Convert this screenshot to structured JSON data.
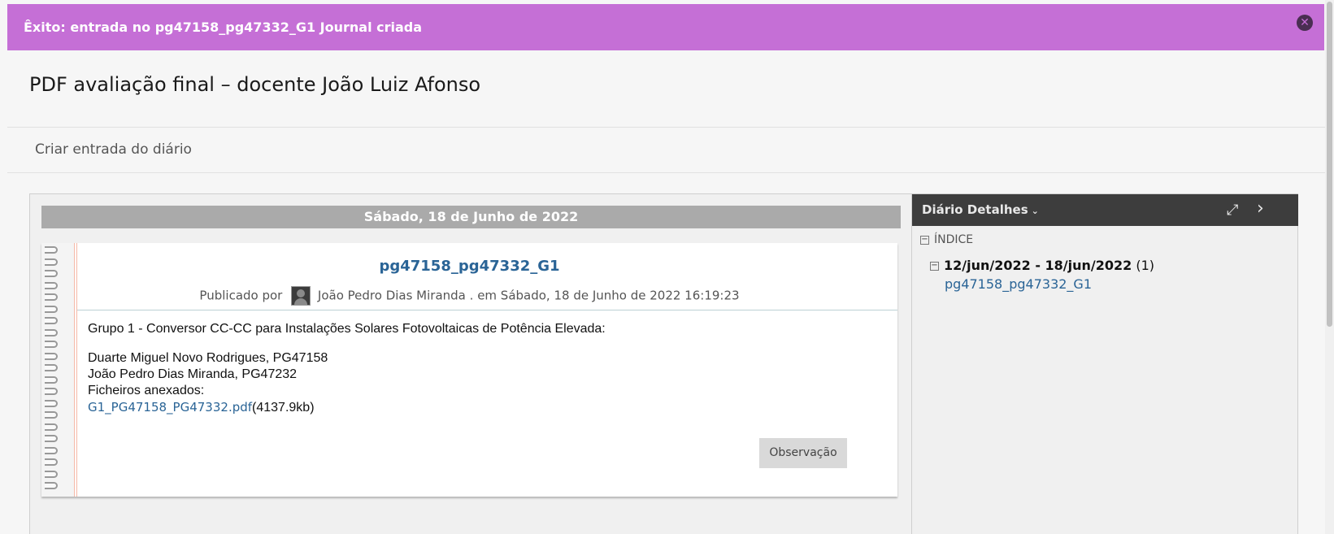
{
  "banner": {
    "message": "Êxito: entrada no pg47158_pg47332_G1 Journal criada",
    "close_icon": "close-circle-icon",
    "color": "#c56fd6"
  },
  "page": {
    "title": "PDF avaliação final – docente João Luiz Afonso"
  },
  "actions": {
    "create_entry": "Criar entrada do diário"
  },
  "journal": {
    "date_header": "Sábado, 18 de Junho de 2022",
    "entry": {
      "title": "pg47158_pg47332_G1",
      "posted_by_label": "Publicado por",
      "author": "João Pedro Dias Miranda .",
      "posted_on": "em Sábado, 18 de Junho de 2022 16:19:23",
      "body_line1": "Grupo 1 - Conversor CC-CC para Instalações Solares Fotovoltaicas de Potência Elevada:",
      "body_line2": "Duarte Miguel Novo Rodrigues, PG47158",
      "body_line3": "João Pedro Dias Miranda, PG47232",
      "attachments_label": "Ficheiros anexados:",
      "attachment_name": "G1_PG47158_PG47332.pdf",
      "attachment_size": "(4137.9kb)",
      "comment_button": "Observação"
    }
  },
  "sidebar": {
    "title": "Diário Detalhes",
    "index_label": "ÍNDICE",
    "week_range": "12/jun/2022 - 18/jun/2022",
    "week_count": "(1)",
    "entry_link": "pg47158_pg47332_G1"
  },
  "colors": {
    "link": "#2a6496",
    "sidebar_header": "#3d3d3d",
    "date_bar": "#aaaaaa"
  }
}
